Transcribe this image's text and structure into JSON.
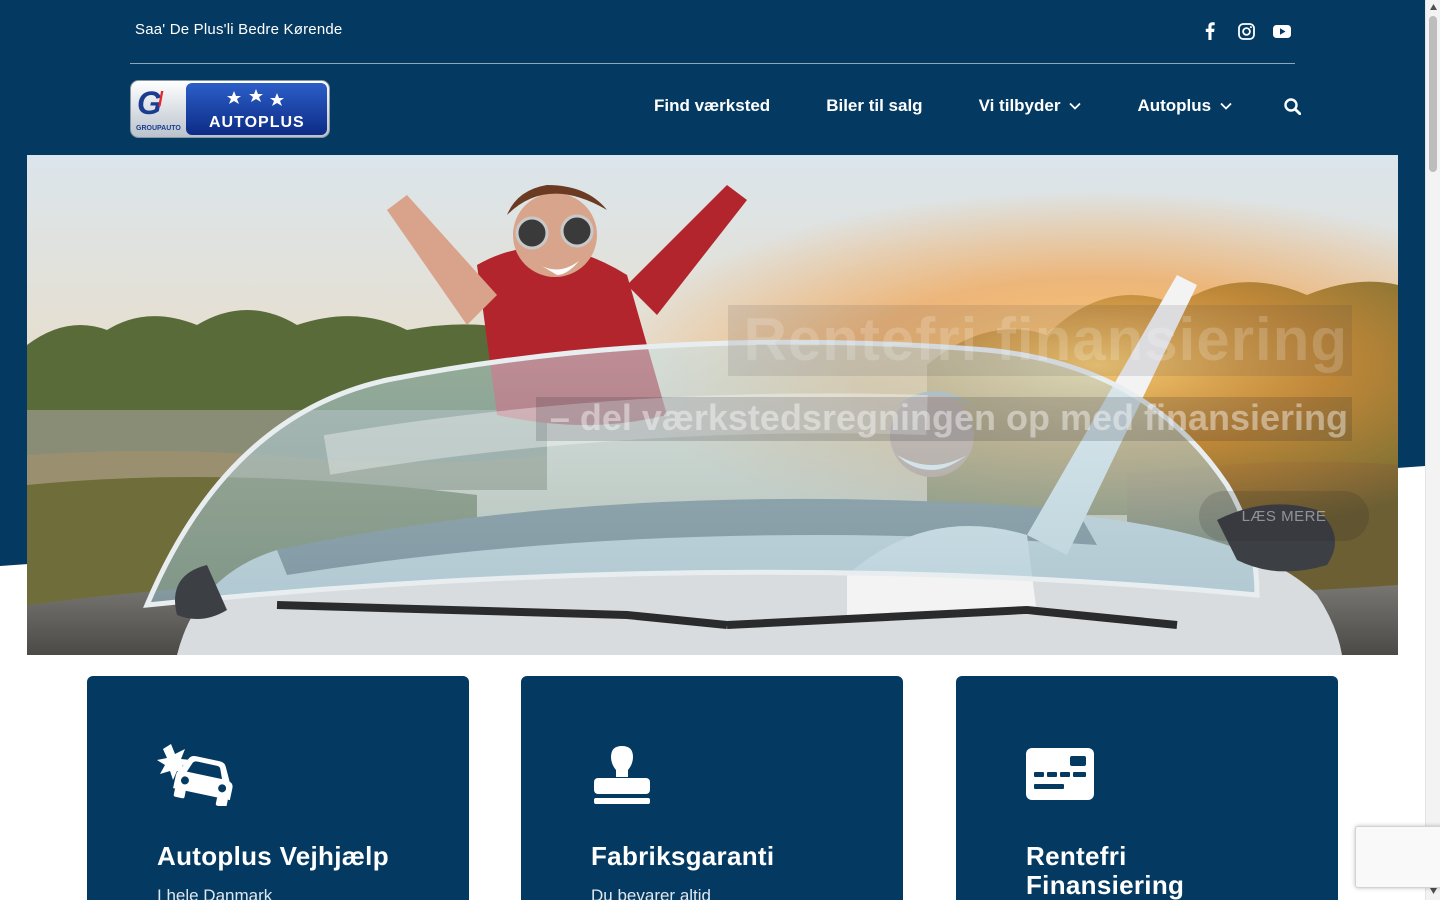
{
  "colors": {
    "brand_navy": "#043a62",
    "white": "#ffffff"
  },
  "topbar": {
    "tagline": "Saa' De Plus'li Bedre Kørende",
    "socials": [
      {
        "name": "facebook-icon"
      },
      {
        "name": "instagram-icon"
      },
      {
        "name": "youtube-icon"
      }
    ]
  },
  "logo": {
    "mark": "G",
    "small": "GROUPAUTO",
    "brand": "AUTOPLUS"
  },
  "nav": {
    "items": [
      {
        "label": "Find værksted",
        "has_dropdown": false
      },
      {
        "label": "Biler til salg",
        "has_dropdown": false
      },
      {
        "label": "Vi tilbyder",
        "has_dropdown": true
      },
      {
        "label": "Autoplus",
        "has_dropdown": true
      }
    ],
    "search_icon": "search-icon"
  },
  "hero": {
    "title": "Rentefri finansiering",
    "subtitle": "– del værkstedsregningen op med finansiering",
    "button": "LÆS MERE"
  },
  "cards": [
    {
      "icon": "car-crash-icon",
      "title": "Autoplus Vejhjælp",
      "text": "I hele Danmark"
    },
    {
      "icon": "stamp-icon",
      "title": "Fabriksgaranti",
      "text": "Du bevarer altid"
    },
    {
      "icon": "payment-card-icon",
      "title": "Rentefri Finansiering",
      "text": ""
    }
  ]
}
